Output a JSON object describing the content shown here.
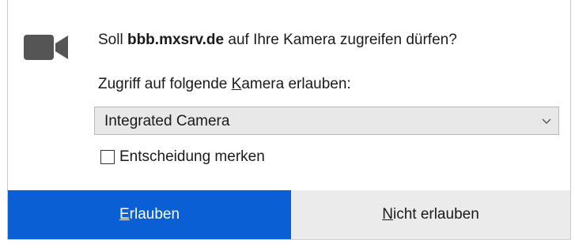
{
  "dialog": {
    "title_prefix": "Soll ",
    "title_host": "bbb.mxsrv.de",
    "title_suffix": " auf Ihre Kamera zugreifen dürfen?",
    "device_label_pre": "Zugriff auf folgende ",
    "device_label_key": "K",
    "device_label_post": "amera erlauben:",
    "device_select": {
      "selected": "Integrated Camera",
      "icon": "chevron-down-icon"
    },
    "remember": {
      "label": "Entscheidung merken",
      "checked": false
    },
    "buttons": {
      "allow": {
        "key": "E",
        "rest": "rlauben",
        "color": "#0a5fd4"
      },
      "deny": {
        "key": "N",
        "rest": "icht erlauben",
        "color": "#ebebeb"
      }
    },
    "icon": "camera-icon",
    "icon_color": "#555555"
  }
}
